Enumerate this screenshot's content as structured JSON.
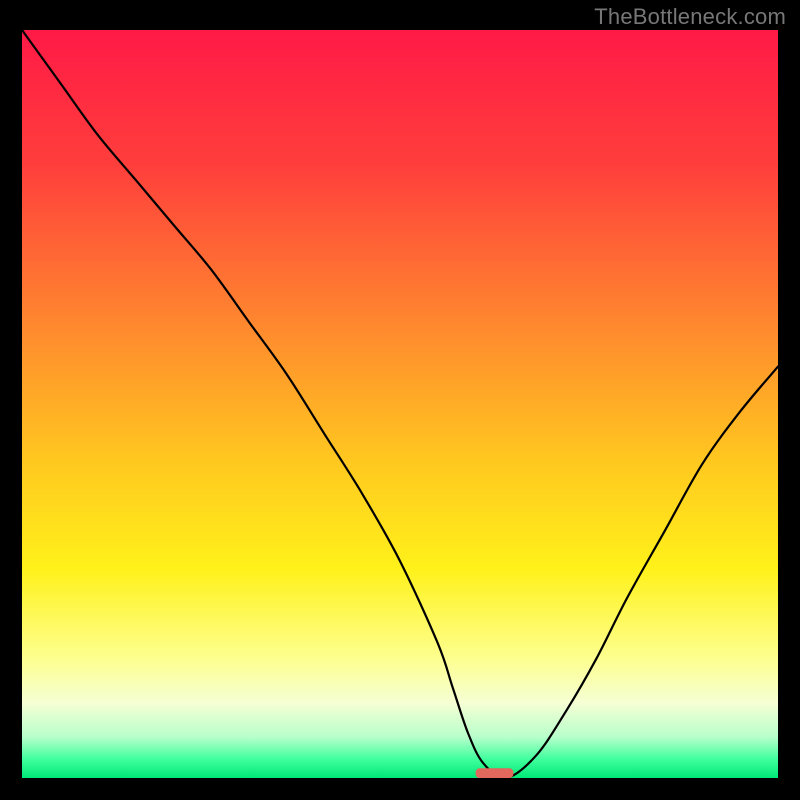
{
  "watermark": "TheBottleneck.com",
  "chart_data": {
    "type": "line",
    "title": "",
    "xlabel": "",
    "ylabel": "",
    "xlim": [
      0,
      100
    ],
    "ylim": [
      0,
      100
    ],
    "gradient_stops": [
      {
        "offset": 0,
        "color": "#ff1a46"
      },
      {
        "offset": 0.18,
        "color": "#ff3e3c"
      },
      {
        "offset": 0.4,
        "color": "#ff8a2e"
      },
      {
        "offset": 0.58,
        "color": "#ffc91f"
      },
      {
        "offset": 0.72,
        "color": "#fff11a"
      },
      {
        "offset": 0.84,
        "color": "#fdff8f"
      },
      {
        "offset": 0.9,
        "color": "#f5ffd4"
      },
      {
        "offset": 0.945,
        "color": "#b8ffcb"
      },
      {
        "offset": 0.975,
        "color": "#3fff9d"
      },
      {
        "offset": 1.0,
        "color": "#00e876"
      }
    ],
    "series": [
      {
        "name": "bottleneck-curve",
        "x": [
          0,
          5,
          10,
          15,
          20,
          25,
          30,
          35,
          40,
          45,
          50,
          55,
          57,
          59,
          61,
          64,
          68,
          72,
          76,
          80,
          85,
          90,
          95,
          100
        ],
        "y": [
          100,
          93,
          86,
          80,
          74,
          68,
          61,
          54,
          46,
          38,
          29,
          18,
          12,
          6,
          2,
          0,
          3,
          9,
          16,
          24,
          33,
          42,
          49,
          55
        ]
      }
    ],
    "marker": {
      "x": 62.5,
      "y": 0,
      "w": 5,
      "h": 1.3,
      "color": "#e2675c"
    }
  }
}
